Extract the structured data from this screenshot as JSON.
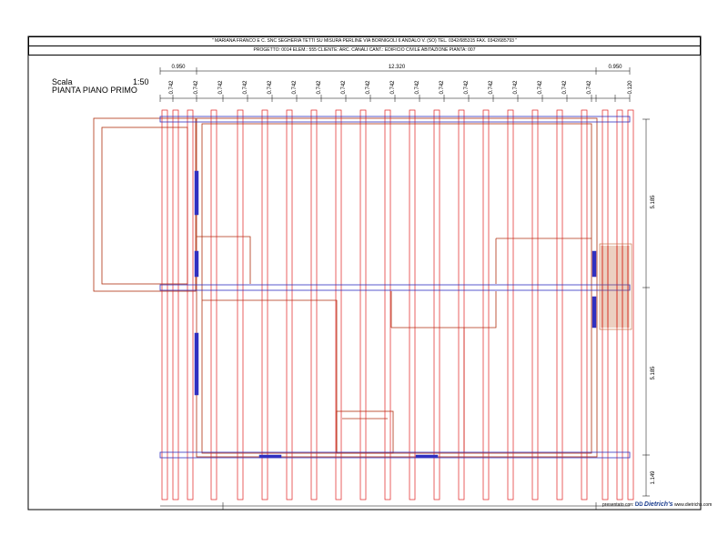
{
  "header": {
    "company_line": "\" MARIANA FRANCO E C. SNC  SEGHERIA TETTI SU MISURA PERLINE  VIA BORNIGOLI 6  ANDALO V. (SO)  TEL. 0342/685315  FAX. 0342/685793 \"",
    "project_line": "PROGETTO: 0014    ELEM.: 555    CLIENTE: ARC. CANALI    CANT.: EDIFICIO CIVILE ABITAZIONE    PIANTA: 007"
  },
  "drawing": {
    "scale_label": "Scala",
    "scale_value": "1:50",
    "title": "PIANTA PIANO PRIMO"
  },
  "dimensions": {
    "top_overall": [
      "0.950",
      "12.320",
      "0.950"
    ],
    "top_spacing": [
      "0.742",
      "0.742",
      "0.742",
      "0.742",
      "0.742",
      "0.742",
      "0.742",
      "0.742",
      "0.742",
      "0.742",
      "0.742",
      "0.742",
      "0.742",
      "0.742",
      "0.742",
      "0.742",
      "0.742",
      "0.742"
    ],
    "top_last": "0.120",
    "right": [
      "5.185",
      "5.185",
      "1.149"
    ]
  },
  "brand": {
    "prefix": "presentato con:",
    "logo": "DD",
    "name": "Dietrich's",
    "url": "www.dietrichs.com"
  },
  "colors": {
    "outline": "#000000",
    "beam": "#e02020",
    "wall": "#b03010",
    "plate": "#3030c0",
    "stair": "#c06030"
  }
}
